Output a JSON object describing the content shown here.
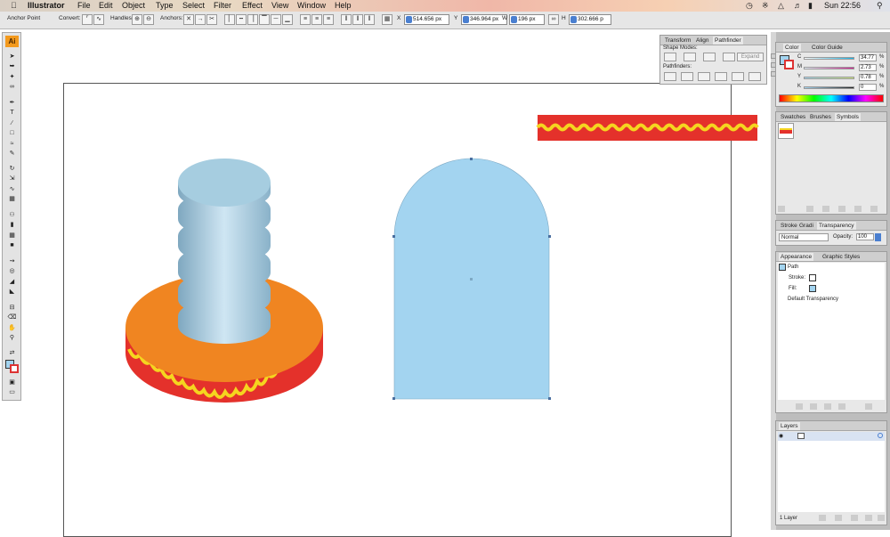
{
  "menubar": {
    "app_name": "Illustrator",
    "items": [
      "File",
      "Edit",
      "Object",
      "Type",
      "Select",
      "Filter",
      "Effect",
      "View",
      "Window",
      "Help"
    ],
    "clock": "Sun 22:56"
  },
  "controlbar": {
    "tool_name": "Anchor Point",
    "convert_label": "Convert:",
    "handles_label": "Handles:",
    "anchors_label": "Anchors:",
    "x_label": "X",
    "x_value": "514.656 px",
    "y_label": "Y",
    "y_value": "346.964 px",
    "w_label": "W",
    "w_value": "196 px",
    "h_label": "H",
    "h_value": "302.666 p"
  },
  "toolbox": {
    "logo": "Ai"
  },
  "pathfinder_panel": {
    "tabs": [
      "Transform",
      "Align",
      "Pathfinder"
    ],
    "shape_modes_label": "Shape Modes:",
    "expand_label": "Expand",
    "pathfinders_label": "Pathfinders:"
  },
  "color_panel": {
    "tabs": [
      "Color",
      "Color Guide"
    ],
    "channels": [
      {
        "label": "C",
        "value": "34.77",
        "color": "#17b3e6"
      },
      {
        "label": "M",
        "value": "2.73",
        "color": "#d2198f"
      },
      {
        "label": "Y",
        "value": "0.78",
        "color": "#e8e21a"
      },
      {
        "label": "K",
        "value": "0",
        "color": "#222222"
      }
    ],
    "percent": "%"
  },
  "swatches_panel": {
    "tabs": [
      "Swatches",
      "Brushes",
      "Symbols"
    ]
  },
  "transparency_panel": {
    "tabs": [
      "Stroke",
      "Gradi",
      "Transparency"
    ],
    "blend_mode": "Normal",
    "opacity_label": "Opacity:",
    "opacity_value": "100"
  },
  "appearance_panel": {
    "tabs": [
      "Appearance",
      "Graphic Styles"
    ],
    "item_type": "Path",
    "stroke_label": "Stroke:",
    "fill_label": "Fill:",
    "default_transparency": "Default Transparency"
  },
  "layers_panel": {
    "tabs": [
      "Layers"
    ],
    "layer_count": "1 Layer"
  },
  "colors": {
    "shape_blue": "#a3d4f0",
    "disk_orange": "#f08521",
    "disk_red": "#e4312b",
    "wave_yellow": "#f5d51f"
  }
}
